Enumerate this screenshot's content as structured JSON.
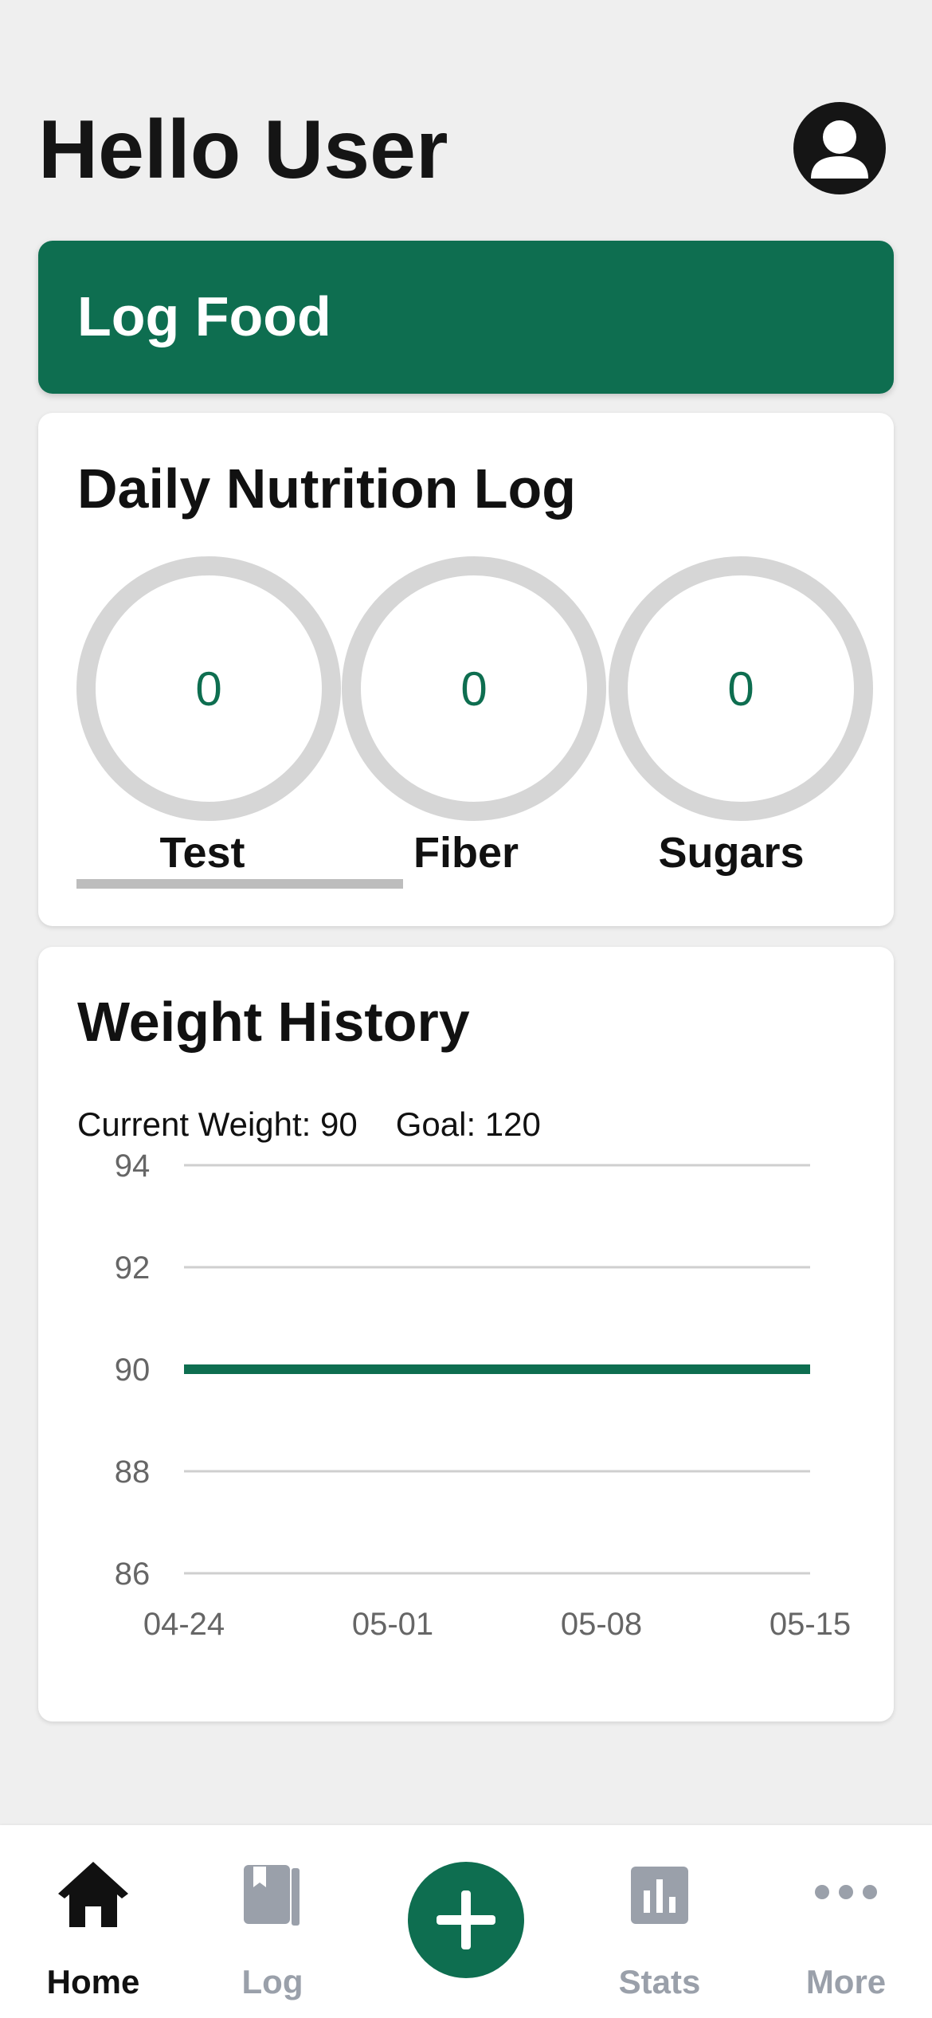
{
  "header": {
    "greeting": "Hello User",
    "avatar_icon": "user-avatar-icon"
  },
  "log_food": {
    "label": "Log Food"
  },
  "nutrition": {
    "title": "Daily Nutrition Log",
    "items": [
      {
        "label": "Test",
        "value": "0"
      },
      {
        "label": "Fiber",
        "value": "0"
      },
      {
        "label": "Sugars",
        "value": "0"
      }
    ],
    "active_tab": "Test"
  },
  "weight": {
    "title": "Weight History",
    "current_label": "Current Weight: 90",
    "goal_label": "Goal: 120"
  },
  "chart_data": {
    "type": "line",
    "x": [
      "04-24",
      "05-01",
      "05-08",
      "05-15"
    ],
    "series": [
      {
        "values": [
          90,
          90,
          90,
          90
        ],
        "color": "#0e6e50"
      }
    ],
    "yticks": [
      "94",
      "92",
      "90",
      "88",
      "86"
    ],
    "ylim": [
      86,
      94
    ],
    "grid": true
  },
  "nav": {
    "items": [
      {
        "label": "Home",
        "icon": "home-icon",
        "active": true
      },
      {
        "label": "Log",
        "icon": "book-icon",
        "active": false
      },
      {
        "label": "",
        "icon": "plus-icon",
        "active": false
      },
      {
        "label": "Stats",
        "icon": "bar-chart-icon",
        "active": false
      },
      {
        "label": "More",
        "icon": "more-dots-icon",
        "active": false
      }
    ],
    "active_color": "#111111",
    "inactive_color": "#9aa0aa"
  },
  "colors": {
    "accent": "#0e6e50",
    "ring": "#d6d6d6",
    "background": "#efefef"
  }
}
